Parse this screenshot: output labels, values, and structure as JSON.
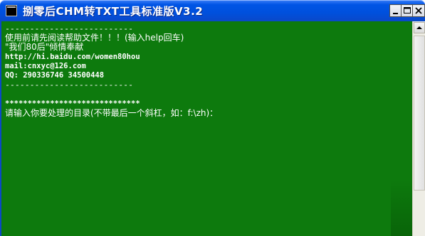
{
  "window": {
    "title": "捌零后CHM转TXT工具标准版V3.2"
  },
  "title_buttons": {
    "minimize_icon": "minimize-icon",
    "maximize_icon": "maximize-icon",
    "close_icon": "close-icon"
  },
  "console": {
    "lines": [
      "--------------------------",
      "使用前请先阅读帮助文件！！！(输入help回车)",
      "\"我们80后\"倾情奉献",
      "http://hi.baidu.com/women80hou",
      "mail:cnxyc@126.com",
      "QQ: 290336746 34500448",
      "--------------------------",
      "",
      "******************************",
      "请输入你要处理的目录(不带最后一个斜杠，如：f:\\zh)："
    ]
  },
  "colors": {
    "console_background": "#0d7a0d",
    "console_text": "#ffffff",
    "titlebar": "#0055e5"
  }
}
